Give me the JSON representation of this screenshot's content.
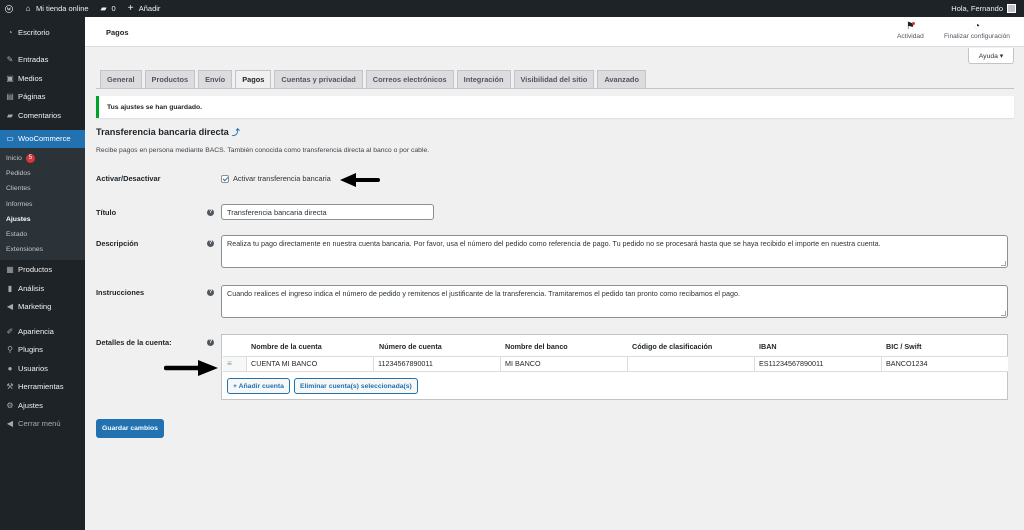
{
  "admin_bar": {
    "site_name": "Mi tienda online",
    "comments_count": "0",
    "new_label": "Añadir",
    "greeting": "Hola, Fernando"
  },
  "sidebar": {
    "top": [
      {
        "label": "Escritorio",
        "icon": "dashboard-icon"
      },
      {
        "label": "Entradas",
        "icon": "pin-icon"
      },
      {
        "label": "Medios",
        "icon": "media-icon"
      },
      {
        "label": "Páginas",
        "icon": "pages-icon"
      },
      {
        "label": "Comentarios",
        "icon": "comments-icon"
      }
    ],
    "woocommerce": "WooCommerce",
    "sub": [
      {
        "label": "Inicio",
        "badge": "5"
      },
      {
        "label": "Pedidos"
      },
      {
        "label": "Clientes"
      },
      {
        "label": "Informes"
      },
      {
        "label": "Ajustes"
      },
      {
        "label": "Estado"
      },
      {
        "label": "Extensiones"
      }
    ],
    "bottom": [
      {
        "label": "Productos",
        "icon": "products-icon"
      },
      {
        "label": "Análisis",
        "icon": "analytics-icon"
      },
      {
        "label": "Marketing",
        "icon": "megaphone-icon"
      },
      {
        "label": "Apariencia",
        "icon": "brush-icon"
      },
      {
        "label": "Plugins",
        "icon": "plugin-icon"
      },
      {
        "label": "Usuarios",
        "icon": "users-icon"
      },
      {
        "label": "Herramientas",
        "icon": "wrench-icon"
      },
      {
        "label": "Ajustes",
        "icon": "settings-icon"
      }
    ],
    "collapse": "Cerrar menú"
  },
  "header": {
    "title": "Pagos",
    "activity": "Actividad",
    "finish_setup": "Finalizar configuración",
    "help": "Ayuda ▾"
  },
  "tabs": [
    "General",
    "Productos",
    "Envío",
    "Pagos",
    "Cuentas y privacidad",
    "Correos electrónicos",
    "Integración",
    "Visibilidad del sitio",
    "Avanzado"
  ],
  "notice": "Tus ajustes se han guardado.",
  "section": {
    "title": "Transferencia bancaria directa",
    "description": "Recibe pagos en persona mediante BACS. También conocida como transferencia directa al banco o por cable."
  },
  "form": {
    "enable_label": "Activar/Desactivar",
    "enable_checkbox": "Activar transferencia bancaria",
    "title_label": "Título",
    "title_value": "Transferencia bancaria directa",
    "description_label": "Descripción",
    "description_value": "Realiza tu pago directamente en nuestra cuenta bancaria. Por favor, usa el número del pedido como referencia de pago. Tu pedido no se procesará hasta que se haya recibido el importe en nuestra cuenta.",
    "instructions_label": "Instrucciones",
    "instructions_value": "Cuando realices el ingreso indica el número de pedido y remitenos el justificante de la transferencia. Tramitaremos el pedido tan pronto como recibamos el pago.",
    "account_details_label": "Detalles de la cuenta:"
  },
  "accounts": {
    "headers": [
      "Nombre de la cuenta",
      "Número de cuenta",
      "Nombre del banco",
      "Código de clasificación",
      "IBAN",
      "BIC / Swift"
    ],
    "row": [
      "CUENTA MI BANCO",
      "11234567890011",
      "MI BANCO",
      "",
      "ES11234567890011",
      "BANCO1234"
    ],
    "add_button": "+ Añadir cuenta",
    "remove_button": "Eliminar cuenta(s) seleccionada(s)"
  },
  "save_button": "Guardar cambios",
  "colors": {
    "admin_dark": "#1d2327",
    "accent": "#2271b1",
    "success": "#00a32a",
    "badge": "#d63638"
  }
}
